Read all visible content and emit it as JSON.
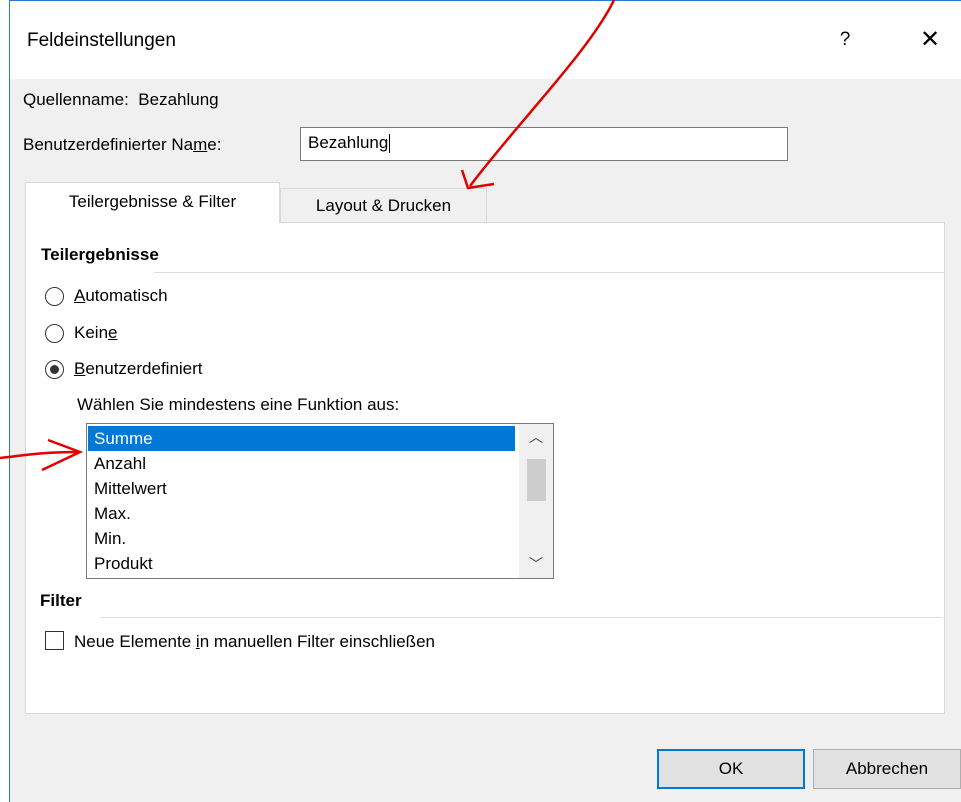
{
  "dialog": {
    "title": "Feldeinstellungen",
    "help": "?",
    "close": "✕"
  },
  "source": {
    "label": "Quellenname:",
    "value": "Bezahlung"
  },
  "custom_name": {
    "label_pre": "Benutzerdefinierter Na",
    "label_u": "m",
    "label_post": "e:",
    "value": "Bezahlung"
  },
  "tabs": [
    {
      "label": "Teilergebnisse & Filter"
    },
    {
      "label": "Layout & Drucken"
    }
  ],
  "subtotals": {
    "heading": "Teilergebnisse",
    "options": [
      {
        "u": "A",
        "rest": "utomatisch",
        "selected": false
      },
      {
        "pre": "Kein",
        "u": "e",
        "selected": false
      },
      {
        "u": "B",
        "rest": "enutzerdefiniert",
        "selected": true
      }
    ],
    "functions_label": "Wählen Sie mindestens eine Funktion aus:",
    "functions": [
      "Summe",
      "Anzahl",
      "Mittelwert",
      "Max.",
      "Min.",
      "Produkt"
    ],
    "selected_function": "Summe"
  },
  "filter": {
    "heading": "Filter",
    "checkbox_pre": "Neue Elemente ",
    "checkbox_u": "i",
    "checkbox_post": "n manuellen Filter einschließen",
    "checked": false
  },
  "buttons": {
    "ok": "OK",
    "cancel": "Abbrechen"
  },
  "colors": {
    "selection": "#0078d7",
    "annotation": "#e00000",
    "accent_border": "#2b79d0"
  }
}
